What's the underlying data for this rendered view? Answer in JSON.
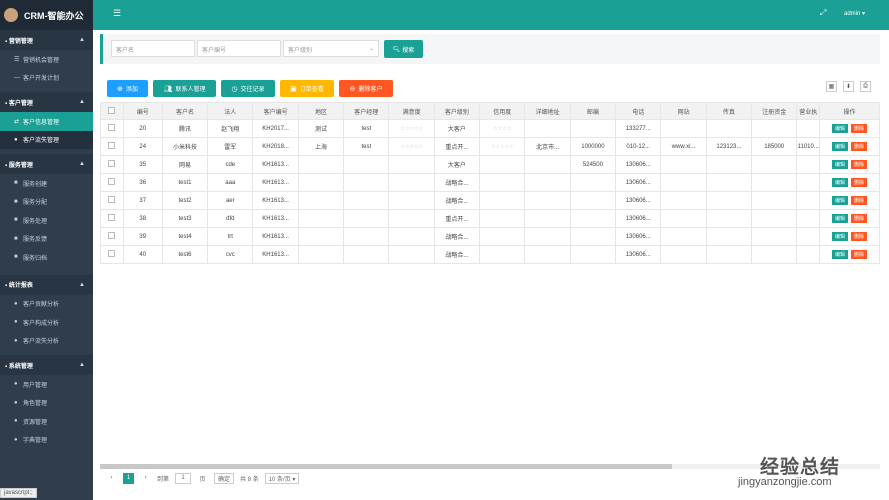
{
  "app": {
    "title": "CRM-智能办公"
  },
  "topbar": {
    "menu_icon": "hamburger-icon",
    "fullscreen_icon": "expand-icon",
    "user": "admin ▾"
  },
  "sidebar": {
    "groups": [
      {
        "label": "营销管理",
        "items": [
          {
            "label": "营销机会管理"
          },
          {
            "label": "客户开发计划"
          }
        ]
      },
      {
        "label": "客户管理",
        "items": [
          {
            "label": "客户信息管理"
          },
          {
            "label": "客户流失管理"
          }
        ]
      },
      {
        "label": "服务管理",
        "items": [
          {
            "label": "服务创建"
          },
          {
            "label": "服务分配"
          },
          {
            "label": "服务处理"
          },
          {
            "label": "服务反馈"
          },
          {
            "label": "服务归档"
          }
        ]
      },
      {
        "label": "统计报表",
        "items": [
          {
            "label": "客户贡献分析"
          },
          {
            "label": "客户构成分析"
          },
          {
            "label": "客户流失分析"
          }
        ]
      },
      {
        "label": "系统管理",
        "items": [
          {
            "label": "用户管理"
          },
          {
            "label": "角色管理"
          },
          {
            "label": "资源管理"
          },
          {
            "label": "字典管理"
          }
        ]
      }
    ]
  },
  "search": {
    "name_placeholder": "客户名",
    "code_placeholder": "客户编号",
    "level_placeholder": "客户级别",
    "button": "搜索"
  },
  "toolbar": {
    "add": "添加",
    "contacts": "联系人管理",
    "records": "交往记录",
    "orders": "订单查看",
    "delete": "删除客户"
  },
  "table": {
    "columns": [
      "",
      "编号",
      "客户名",
      "法人",
      "客户编号",
      "地区",
      "客户经理",
      "满意度",
      "客户级别",
      "信用度",
      "详细地址",
      "邮编",
      "电话",
      "网站",
      "传真",
      "注册资金",
      "营业执",
      "操作"
    ],
    "edit_label": "编辑",
    "delete_label": "删除",
    "rows": [
      [
        "",
        "20",
        "腾讯",
        "赵飞翔",
        "KH2017...",
        "测试",
        "test",
        "☆☆☆☆☆",
        "大客户",
        "☆☆☆☆",
        "",
        "",
        "133277...",
        "",
        "",
        "",
        ""
      ],
      [
        "",
        "24",
        "小米科技",
        "雷军",
        "KH2018...",
        "上海",
        "test",
        "☆☆☆☆☆",
        "重点开...",
        "☆☆☆☆☆",
        "北京市...",
        "1000000",
        "010-12...",
        "www.xi...",
        "123123...",
        "185000",
        "11010..."
      ],
      [
        "",
        "35",
        "网易",
        "cde",
        "KH1613...",
        "",
        "",
        "",
        "大客户",
        "",
        "",
        "524500",
        "130606...",
        "",
        "",
        "",
        ""
      ],
      [
        "",
        "36",
        "test1",
        "aaa",
        "KH1613...",
        "",
        "",
        "",
        "战略合...",
        "",
        "",
        "",
        "130606...",
        "",
        "",
        "",
        ""
      ],
      [
        "",
        "37",
        "test2",
        "aer",
        "KH1613...",
        "",
        "",
        "",
        "战略合...",
        "",
        "",
        "",
        "130606...",
        "",
        "",
        "",
        ""
      ],
      [
        "",
        "38",
        "test3",
        "dfd",
        "KH1613...",
        "",
        "",
        "",
        "重点开...",
        "",
        "",
        "",
        "130606...",
        "",
        "",
        "",
        ""
      ],
      [
        "",
        "39",
        "test4",
        "trt",
        "KH1613...",
        "",
        "",
        "",
        "战略合...",
        "",
        "",
        "",
        "130606...",
        "",
        "",
        "",
        ""
      ],
      [
        "",
        "40",
        "test6",
        "cvc",
        "KH1613...",
        "",
        "",
        "",
        "战略合...",
        "",
        "",
        "",
        "130606...",
        "",
        "",
        "",
        ""
      ]
    ]
  },
  "pager": {
    "current": "1",
    "goto_label": "到第",
    "goto_value": "1",
    "page_unit": "页",
    "confirm": "确定",
    "total": "共 8 条",
    "per_page": "10 条/页 ▾"
  },
  "status_bar": "javascript:;",
  "watermark": {
    "cn": "经验总结",
    "url": "jingyanzongjie.com"
  },
  "colors": {
    "primary": "#1aa094",
    "sidebar": "#2f3d4c",
    "blue": "#1e9fff",
    "orange": "#ffb800",
    "red": "#ff5722"
  }
}
